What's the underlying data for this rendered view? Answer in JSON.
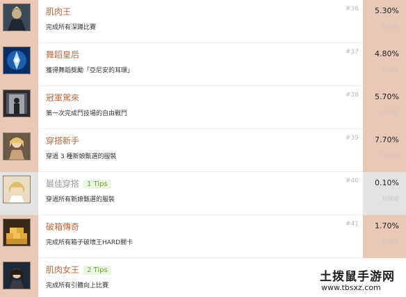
{
  "achievements": [
    {
      "title": "肌肉王",
      "tips": "",
      "desc": "完成所有深蹲比賽",
      "num": "#36",
      "pct": "5.30%",
      "rare": "珍稀度",
      "icon": "muscle-king-icon"
    },
    {
      "title": "舞蹈皇后",
      "tips": "",
      "desc": "獲得舞蹈獎勵「亞尼安的耳環」",
      "num": "#37",
      "pct": "4.80%",
      "rare": "珍稀度",
      "icon": "earring-icon"
    },
    {
      "title": "冠軍駕來",
      "tips": "",
      "desc": "第一次完成鬥技場的自由戰鬥",
      "num": "#38",
      "pct": "5.70%",
      "rare": "珍稀度",
      "icon": "champion-icon"
    },
    {
      "title": "穿搭新手",
      "tips": "",
      "desc": "穿過 3 種新娘甄選的服裝",
      "num": "#39",
      "pct": "7.70%",
      "rare": "珍稀度",
      "icon": "outfit-novice-icon"
    },
    {
      "title": "最佳穿搭",
      "tips": "1 Tips",
      "desc": "穿過所有新娘甄選的服裝",
      "num": "#40",
      "pct": "0.10%",
      "rare": "珍稀度",
      "icon": "best-outfit-icon"
    },
    {
      "title": "破箱傳奇",
      "tips": "",
      "desc": "完成所有箱子破壞王HARD關卡",
      "num": "#41",
      "pct": "1.70%",
      "rare": "珍稀度",
      "icon": "box-legend-icon"
    },
    {
      "title": "肌肉女王",
      "tips": "2 Tips",
      "desc": "完成所有引體向上比賽",
      "num": "",
      "pct": "",
      "rare": "",
      "icon": "muscle-queen-icon"
    }
  ],
  "watermark": {
    "top": "土拨鼠手游网",
    "bottom": "www.tbsxz.com"
  }
}
